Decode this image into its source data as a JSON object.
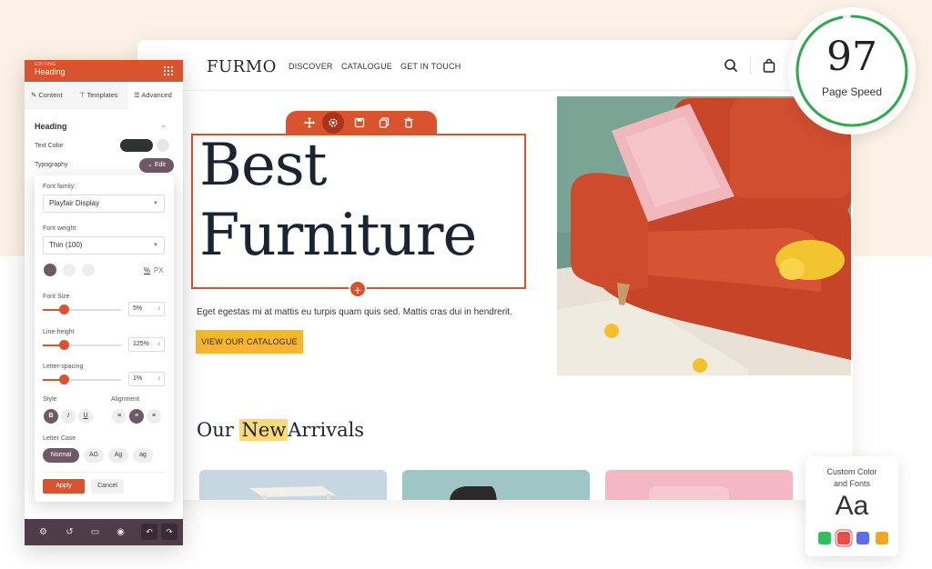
{
  "site": {
    "logo": "FURMO",
    "nav": [
      "DISCOVER",
      "CATALOGUE",
      "GET IN TOUCH"
    ],
    "icons": [
      "search-icon",
      "bag-icon"
    ],
    "headline_1": "Best",
    "headline_2": "Furniture",
    "subtext": "Eget egestas mi at mattis eu turpis quam quis sed. Mattis cras dui in hendrerit.",
    "cta": "VIEW OUR CATALOGUE",
    "arrivals_pre": "Our",
    "arrivals_hl": "New",
    "arrivals_post": "Arrivals",
    "toolbar_icons": [
      "move-icon",
      "settings-icon",
      "save-icon",
      "copy-icon",
      "trash-icon"
    ],
    "add_icon": "plus-icon"
  },
  "panel": {
    "editing": "EDITING",
    "title": "Heading",
    "tabs": [
      "Content",
      "Templates",
      "Advanced"
    ],
    "section": "Heading",
    "text_color_label": "Text Color",
    "typography_label": "Typography",
    "edit_label": "Edit",
    "font_family_label": "Font family:",
    "font_family_value": "Playfair Display",
    "font_weight_label": "Font weight:",
    "font_weight_value": "Thin (100)",
    "unit_pct": "%",
    "unit_px": "PX",
    "font_size_label": "Font Size",
    "font_size_value": "5%",
    "line_height_label": "Line-height",
    "line_height_value": "125%",
    "letter_spacing_label": "Letter-spacing",
    "letter_spacing_value": "1%",
    "style_label": "Style",
    "style_buttons": [
      "B",
      "I",
      "U"
    ],
    "alignment_label": "Alignment",
    "letter_case_label": "Letter Case",
    "letter_case_options": [
      "Normal",
      "AG",
      "Ag",
      "ag"
    ],
    "apply": "Apply",
    "cancel": "Cancel"
  },
  "speed": {
    "score": "97",
    "label": "Page Speed",
    "score_fraction": 0.97,
    "ring_color": "#2fa84f"
  },
  "custom": {
    "title_1": "Custom Color",
    "title_2": "and Fonts",
    "sample": "Aa",
    "swatches": [
      "#2fbf5b",
      "#ef4b4b",
      "#5e6ef0",
      "#f5a623"
    ]
  },
  "colors": {
    "accent": "#d9532f",
    "cta": "#f6b72d",
    "panel_footer": "#4e3d48"
  }
}
